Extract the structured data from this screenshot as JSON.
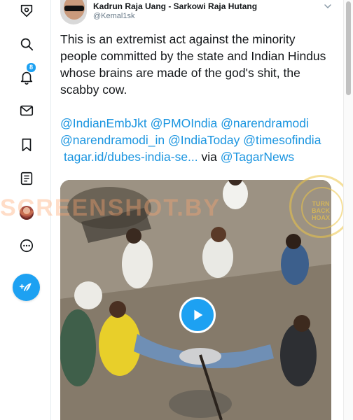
{
  "sidebar": {
    "items": [
      {
        "name": "home",
        "icon": "home-icon"
      },
      {
        "name": "explore",
        "icon": "search-icon"
      },
      {
        "name": "notifications",
        "icon": "bell-icon",
        "badge": "8"
      },
      {
        "name": "messages",
        "icon": "mail-icon"
      },
      {
        "name": "bookmarks",
        "icon": "bookmark-icon"
      },
      {
        "name": "lists",
        "icon": "list-icon"
      },
      {
        "name": "profile",
        "icon": "avatar"
      },
      {
        "name": "more",
        "icon": "more-icon"
      }
    ],
    "compose_icon": "compose-tweet-icon"
  },
  "tweet": {
    "author_name": "Kadrun Raja Uang - Sarkowi Raja Hutang",
    "author_handle": "@Kemal1sk",
    "text": "This is an extremist act against the minority people committed by the state and Indian Hindus whose brains are made of the god's shit, the scabby cow.",
    "mentions": [
      "@IndianEmbJkt",
      "@PMOIndia",
      "@narendramodi",
      "@narendramodi_in",
      "@IndiaToday",
      "@timesofindia"
    ],
    "link_text": "tagar.id/dubes-india-se...",
    "via_text": "via",
    "via_handle": "@TagarNews"
  },
  "overlay": {
    "watermark": "SCREENSHOT.BY",
    "seal_text": "TURN\nBACK\nHOAX"
  },
  "colors": {
    "accent": "#1da1f2",
    "link": "#1b95e0",
    "text": "#14171a",
    "muted": "#657786"
  }
}
